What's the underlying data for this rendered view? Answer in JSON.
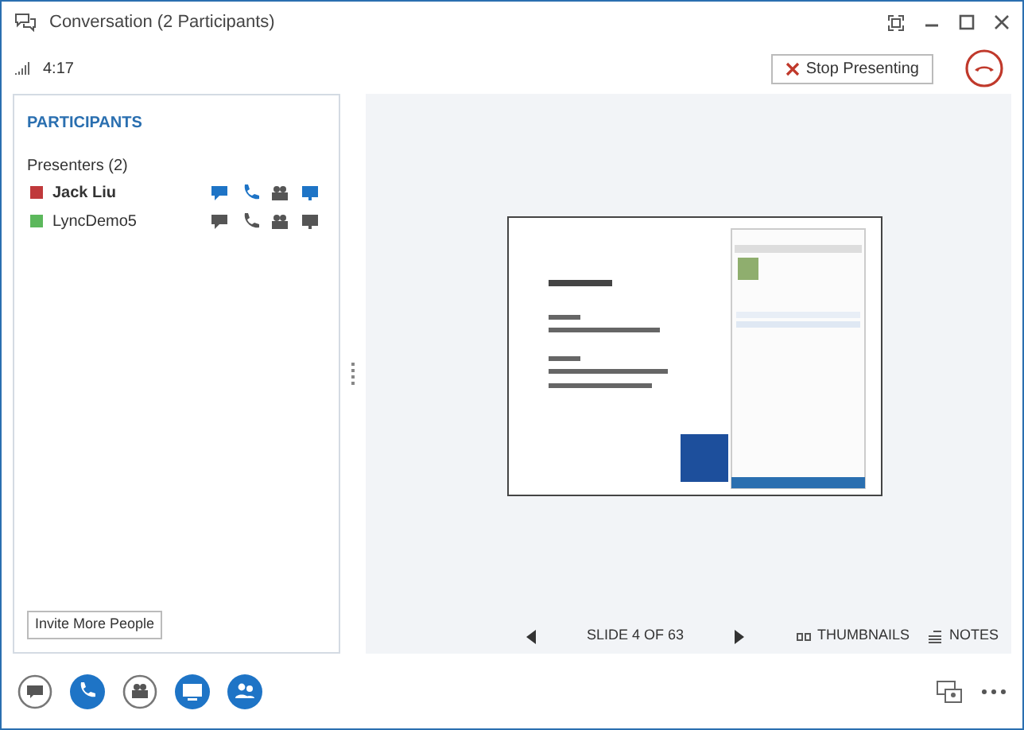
{
  "window": {
    "title": "Conversation (2 Participants)"
  },
  "call": {
    "duration": "4:17",
    "stop_button": "Stop Presenting"
  },
  "participants": {
    "heading": "PARTICIPANTS",
    "group": "Presenters (2)",
    "people": [
      {
        "name": "Jack Liu",
        "color": "#c0393b",
        "me": true,
        "im": true,
        "audio": true,
        "video": false,
        "share": true
      },
      {
        "name": "LyncDemo5",
        "color": "#5cb85c",
        "me": false,
        "im": false,
        "audio": false,
        "video": false,
        "share": false
      }
    ],
    "invite_button": "Invite More People"
  },
  "stage": {
    "counter": "SLIDE 4 OF 63",
    "thumbnails": "THUMBNAILS",
    "notes": "NOTES"
  },
  "toolbar": [
    {
      "kind": "im",
      "active": false
    },
    {
      "kind": "audio",
      "active": true
    },
    {
      "kind": "video",
      "active": false
    },
    {
      "kind": "share",
      "active": true
    },
    {
      "kind": "people",
      "active": true
    }
  ]
}
